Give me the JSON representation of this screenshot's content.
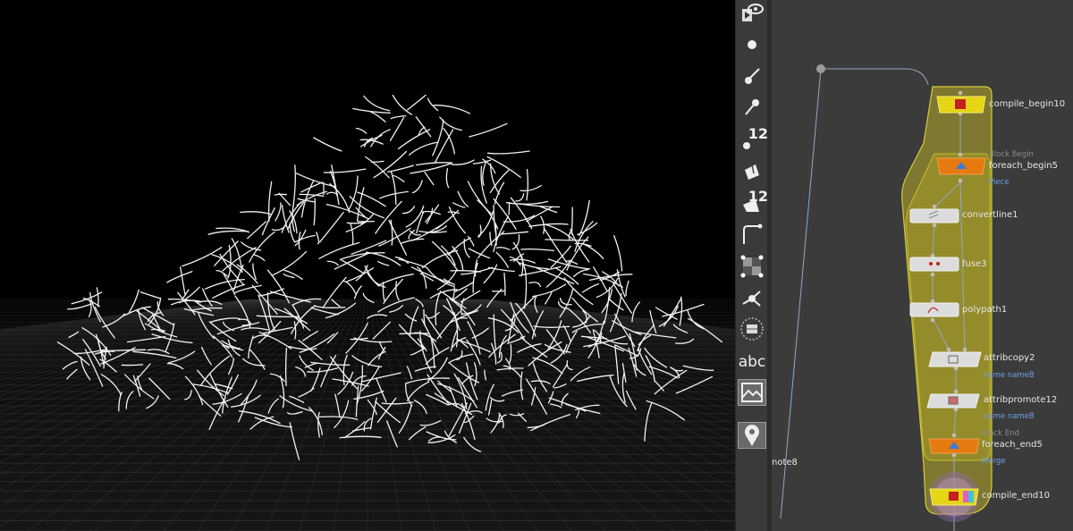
{
  "viewport": {
    "description_hidden": ""
  },
  "toolbar": {
    "tools": [
      {
        "name": "view-tool-icon",
        "num": ""
      },
      {
        "name": "point-display-icon",
        "num": ""
      },
      {
        "name": "paint-brush-icon",
        "num": ""
      },
      {
        "name": "pen-icon",
        "num": ""
      },
      {
        "name": "point-number-icon",
        "num": "12"
      },
      {
        "name": "primitive-display-icon",
        "num": ""
      },
      {
        "name": "primitive-number-icon",
        "num": "12"
      },
      {
        "name": "normals-icon",
        "num": ""
      },
      {
        "name": "uv-checker-icon",
        "num": ""
      },
      {
        "name": "handles-icon",
        "num": ""
      },
      {
        "name": "grid-icon",
        "num": ""
      },
      {
        "name": "text-labels-icon",
        "num": "",
        "text": "abc"
      },
      {
        "name": "background-image-icon",
        "num": ""
      },
      {
        "name": "pin-icon",
        "num": ""
      }
    ]
  },
  "network": {
    "nodes": {
      "compile_begin": {
        "label": "compile_begin10",
        "color": "#e6d417"
      },
      "foreach_begin": {
        "label": "foreach_begin5",
        "header": "Block Begin",
        "sub": "Piece",
        "color": "#e57a10"
      },
      "convertline": {
        "label": "convertline1",
        "color": "#d9d9d9"
      },
      "fuse": {
        "label": "fuse3",
        "color": "#d9d9d9"
      },
      "polypath": {
        "label": "polypath1",
        "color": "#d9d9d9"
      },
      "attribcopy": {
        "label": "attribcopy2",
        "sub": "name nameB",
        "color": "#d9d9d9"
      },
      "attribpromote": {
        "label": "attribpromote12",
        "sub": "name nameB",
        "color": "#d9d9d9"
      },
      "foreach_end": {
        "label": "foreach_end5",
        "header": "Block End",
        "sub": "Merge",
        "color": "#e57a10"
      },
      "compile_end": {
        "label": "compile_end10",
        "color": "#e6d417"
      }
    },
    "sticky_note": "note8",
    "colors": {
      "block": "#b7ac2a",
      "wire": "#8fa8c8",
      "background": "#3b3b3b"
    }
  }
}
